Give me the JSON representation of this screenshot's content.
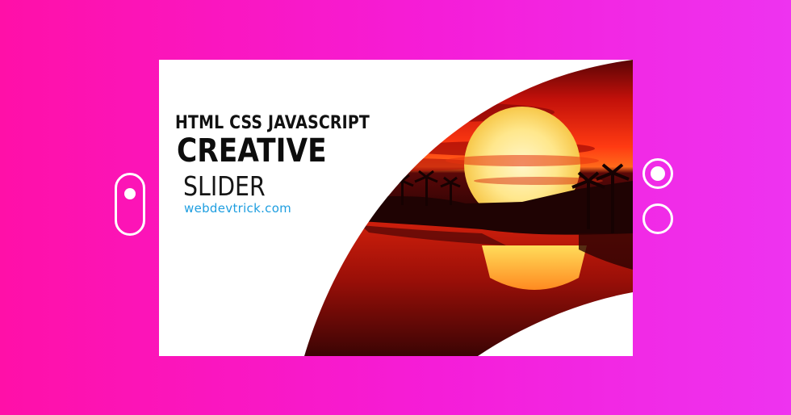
{
  "slide": {
    "subtitle": "HTML CSS JAVASCRIPT",
    "title": "CREATIVE",
    "title_line2": "SLIDER",
    "site": "webdevtrick.com"
  },
  "controls": {
    "toggle": "on",
    "active_slide": 1,
    "total_slides": 2
  },
  "icons": {
    "toggle": "toggle-switch-icon",
    "dot_active": "filled-radio-dot-icon",
    "dot_inactive": "empty-radio-dot-icon"
  },
  "colors": {
    "background_left": "#ff10a8",
    "background_right": "#ee33f0",
    "card": "#ffffff",
    "link": "#1e9ee0",
    "sunset_red": "#e01a0c",
    "sun": "#fbe56a"
  }
}
